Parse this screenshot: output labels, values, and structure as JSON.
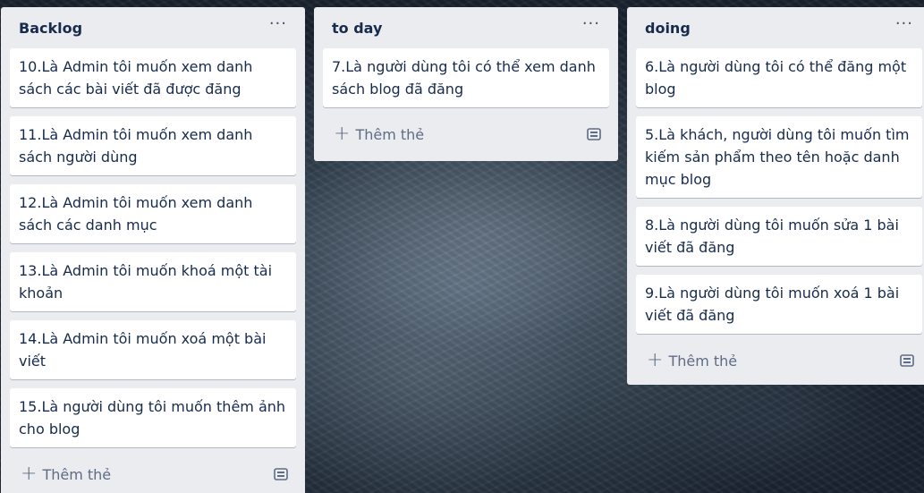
{
  "lists": [
    {
      "title": "Backlog",
      "menu": "···",
      "cards": [
        "10.Là Admin tôi muốn xem danh sách các bài viết đã được đăng",
        "11.Là Admin tôi muốn xem danh sách người dùng",
        "12.Là Admin tôi muốn xem danh sách các danh mục",
        "13.Là Admin tôi muốn khoá một tài khoản",
        "14.Là Admin tôi muốn xoá một bài viết",
        "15.Là người dùng tôi muốn thêm ảnh cho blog"
      ],
      "add_label": "Thêm thẻ"
    },
    {
      "title": "to day",
      "menu": "···",
      "cards": [
        "7.Là người dùng tôi có thể xem danh sách blog đã đăng"
      ],
      "add_label": "Thêm thẻ"
    },
    {
      "title": "doing",
      "menu": "···",
      "cards": [
        "6.Là người dùng tôi có thể đăng một blog",
        "5.Là khách, người dùng tôi muốn tìm kiếm sản phẩm theo tên hoặc danh mục blog",
        "8.Là người dùng tôi muốn sửa 1 bài viết đã đăng",
        "9.Là người dùng tôi muốn xoá 1 bài viết đã đăng"
      ],
      "add_label": "Thêm thẻ"
    }
  ],
  "icons": {
    "add": "plus-icon",
    "template": "card-template-icon",
    "menu": "more-horizontal-icon"
  },
  "colors": {
    "list_bg": "#ebecf0",
    "card_bg": "#ffffff",
    "title_text": "#172b4d",
    "muted_text": "#5e6c84"
  }
}
